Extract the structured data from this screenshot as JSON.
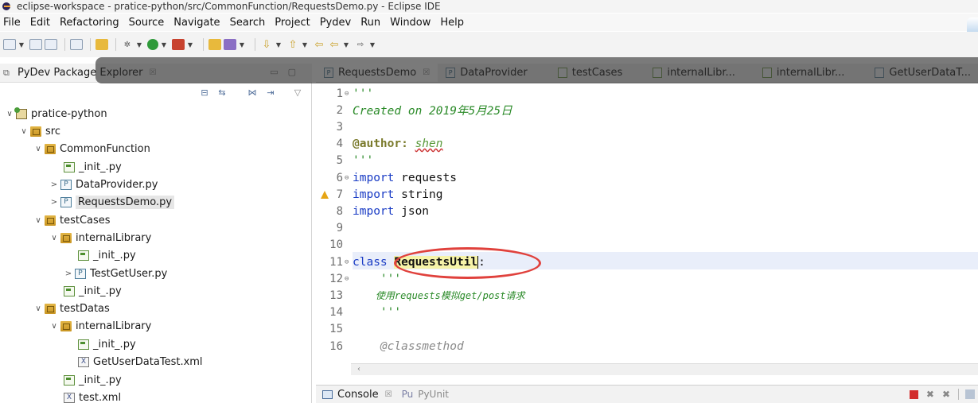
{
  "window": {
    "title": "eclipse-workspace - pratice-python/src/CommonFunction/RequestsDemo.py - Eclipse IDE"
  },
  "menu": [
    "File",
    "Edit",
    "Refactoring",
    "Source",
    "Navigate",
    "Search",
    "Project",
    "Pydev",
    "Run",
    "Window",
    "Help"
  ],
  "explorer": {
    "title": "PyDev Package Explorer",
    "close_glyph": "☒",
    "tree": [
      {
        "label": "pratice-python",
        "icon": "project-icon",
        "twisty": "∨"
      },
      {
        "label": "src",
        "icon": "source-folder-icon",
        "twisty": "∨"
      },
      {
        "label": "CommonFunction",
        "icon": "package-icon",
        "twisty": "∨"
      },
      {
        "label": "_init_.py",
        "icon": "python-init-icon",
        "twisty": ""
      },
      {
        "label": "DataProvider.py",
        "icon": "python-file-icon",
        "twisty": ">"
      },
      {
        "label": "RequestsDemo.py",
        "icon": "python-file-icon",
        "twisty": ">"
      },
      {
        "label": "testCases",
        "icon": "package-icon",
        "twisty": "∨"
      },
      {
        "label": "internalLibrary",
        "icon": "package-icon",
        "twisty": "∨"
      },
      {
        "label": "_init_.py",
        "icon": "python-init-icon",
        "twisty": ""
      },
      {
        "label": "TestGetUser.py",
        "icon": "python-file-icon",
        "twisty": ">"
      },
      {
        "label": "_init_.py",
        "icon": "python-init-icon",
        "twisty": ""
      },
      {
        "label": "testDatas",
        "icon": "package-icon",
        "twisty": "∨"
      },
      {
        "label": "internalLibrary",
        "icon": "package-icon",
        "twisty": "∨"
      },
      {
        "label": "_init_.py",
        "icon": "python-init-icon",
        "twisty": ""
      },
      {
        "label": "GetUserDataTest.xml",
        "icon": "xml-file-icon",
        "twisty": ""
      },
      {
        "label": "_init_.py",
        "icon": "python-init-icon",
        "twisty": ""
      },
      {
        "label": "test.xml",
        "icon": "xml-file-icon",
        "twisty": ""
      }
    ]
  },
  "editor_tabs": [
    {
      "label": "RequestsDemo",
      "active": true,
      "close": "☒"
    },
    {
      "label": "DataProvider",
      "active": false
    },
    {
      "label": "testCases",
      "active": false
    },
    {
      "label": "internalLibr...",
      "active": false
    },
    {
      "label": "internalLibr...",
      "active": false
    },
    {
      "label": "GetUserDataT...",
      "active": false
    }
  ],
  "editor": {
    "lines": [
      {
        "n": "1",
        "fold": "⊖",
        "parts": [
          [
            "cm",
            "'''"
          ]
        ]
      },
      {
        "n": "2",
        "fold": "",
        "parts": [
          [
            "cm",
            "Created on 2019年5月25日"
          ]
        ]
      },
      {
        "n": "3",
        "fold": "",
        "parts": []
      },
      {
        "n": "4",
        "fold": "",
        "parts": [
          [
            "annot",
            "@author:"
          ],
          [
            "code",
            " "
          ],
          [
            "author",
            "shen"
          ]
        ]
      },
      {
        "n": "5",
        "fold": "",
        "parts": [
          [
            "cm",
            "'''"
          ]
        ]
      },
      {
        "n": "6",
        "fold": "⊖",
        "parts": [
          [
            "kw",
            "import"
          ],
          [
            "code",
            " requests"
          ]
        ]
      },
      {
        "n": "7",
        "fold": "",
        "parts": [
          [
            "kw",
            "import"
          ],
          [
            "code",
            " string"
          ]
        ]
      },
      {
        "n": "8",
        "fold": "",
        "parts": [
          [
            "kw",
            "import"
          ],
          [
            "code",
            " json"
          ]
        ]
      },
      {
        "n": "9",
        "fold": "",
        "parts": []
      },
      {
        "n": "10",
        "fold": "",
        "parts": []
      },
      {
        "n": "11",
        "fold": "⊖",
        "parts": [
          [
            "kw",
            "class"
          ],
          [
            "code",
            " "
          ],
          [
            "hl",
            "RequestsUtil"
          ],
          [
            "code",
            ":"
          ]
        ]
      },
      {
        "n": "12",
        "fold": "⊖",
        "parts": [
          [
            "cm",
            "    '''"
          ]
        ]
      },
      {
        "n": "13",
        "fold": "",
        "parts": [
          [
            "cmc",
            "    使用requests模拟get/post请求"
          ]
        ]
      },
      {
        "n": "14",
        "fold": "",
        "parts": [
          [
            "cm",
            "    '''"
          ]
        ]
      },
      {
        "n": "15",
        "fold": "",
        "parts": []
      },
      {
        "n": "16",
        "fold": "",
        "parts": [
          [
            "deco",
            "    @classmethod"
          ]
        ]
      }
    ]
  },
  "console": {
    "tab_label": "Console",
    "close_glyph": "☒",
    "pyunit_label": "PyUnit",
    "pyunit_prefix": "Pu"
  }
}
